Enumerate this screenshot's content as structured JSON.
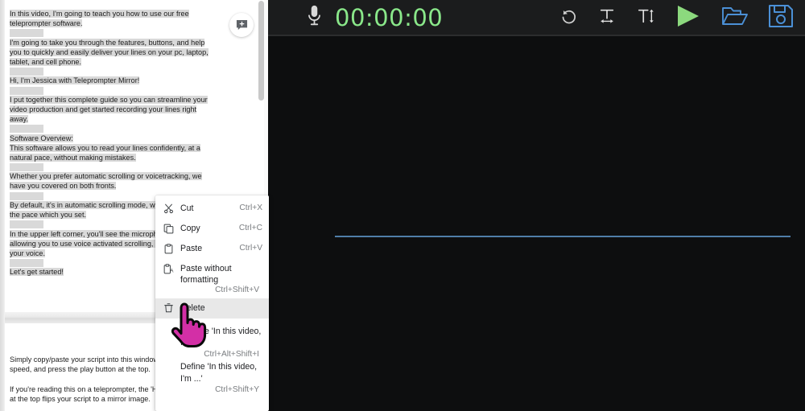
{
  "document": {
    "paragraphs": [
      "In this video, I'm going to teach you how to use our free teleprompter software.",
      "I'm going to take you through the features, buttons, and help you to quickly and easily deliver your lines on your pc, laptop, tablet, and cell phone.",
      "Hi, I'm Jessica with Teleprompter Mirror!",
      "I put together this complete guide so you can streamline your video production and get started recording your lines right away.",
      "Software Overview:",
      "This software allows you to read your lines confidently, at a natural pace, without making mistakes.",
      "Whether you prefer automatic scrolling or voicetracking, we have you covered on both fronts.",
      "By default, it's in automatic scrolling mode, which scrolls at the pace which you set.",
      "In the upper left corner, you'll see the microphone button allowing you to use voice activated scrolling, which follows your voice.",
      "Let's get started!"
    ],
    "page2_paragraphs": [
      "Simply copy/paste your script into this window, adjust the speed, and press the play button at the top.",
      "If you're reading this on a teleprompter, the 'Horizontal' button at the top flips your script to a mirror image."
    ],
    "comment_button_label": "add-comment"
  },
  "teleprompter": {
    "timer": "00:00:00",
    "timer_color": "#8ae88a",
    "mic_icon": "microphone-icon",
    "tools": [
      {
        "name": "reset-icon",
        "label": "Reset"
      },
      {
        "name": "text-width-icon",
        "label": "Text width"
      },
      {
        "name": "text-height-icon",
        "label": "Text height"
      },
      {
        "name": "play-icon",
        "label": "Play"
      },
      {
        "name": "open-folder-icon",
        "label": "Open"
      },
      {
        "name": "save-icon",
        "label": "Save"
      }
    ],
    "play_color": "#8cd97e",
    "file_icon_color": "#4b90d6",
    "reading_line_color": "#4f7ea8"
  },
  "context_menu": {
    "items": [
      {
        "label": "Cut",
        "shortcut": "Ctrl+X",
        "icon": "scissors-icon"
      },
      {
        "label": "Copy",
        "shortcut": "Ctrl+C",
        "icon": "copy-icon"
      },
      {
        "label": "Paste",
        "shortcut": "Ctrl+V",
        "icon": "clipboard-icon"
      },
      {
        "label": "Paste without formatting",
        "shortcut": "Ctrl+Shift+V",
        "icon": "clipboard-text-icon"
      },
      {
        "label": "Delete",
        "shortcut": "",
        "icon": "trash-icon"
      }
    ],
    "explore": {
      "label": "Explore 'In this video, I'm ...'",
      "shortcut": "Ctrl+Alt+Shift+I"
    },
    "define": {
      "label": "Define 'In this video, I'm ...'",
      "shortcut": "Ctrl+Shift+Y"
    }
  }
}
